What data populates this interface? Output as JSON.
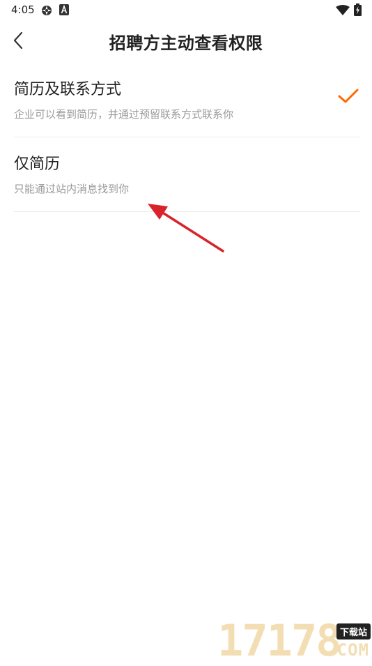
{
  "status_bar": {
    "time": "4:05",
    "icons": [
      "settings-gear-icon",
      "font-a-icon",
      "wifi-icon",
      "battery-icon"
    ]
  },
  "header": {
    "title": "招聘方主动查看权限",
    "back_icon": "chevron-left-icon"
  },
  "options": [
    {
      "title": "简历及联系方式",
      "description": "企业可以看到简历，并通过预留联系方式联系你",
      "selected": true
    },
    {
      "title": "仅简历",
      "description": "只能通过站内消息找到你",
      "selected": false
    }
  ],
  "colors": {
    "accent": "#ff6a00",
    "annotation": "#d9232a",
    "text_primary": "#222222",
    "text_secondary": "#9a9a9a",
    "divider": "#ececec"
  },
  "watermark": {
    "digits": "17178",
    "badge": "下载站",
    "suffix": "COM"
  }
}
